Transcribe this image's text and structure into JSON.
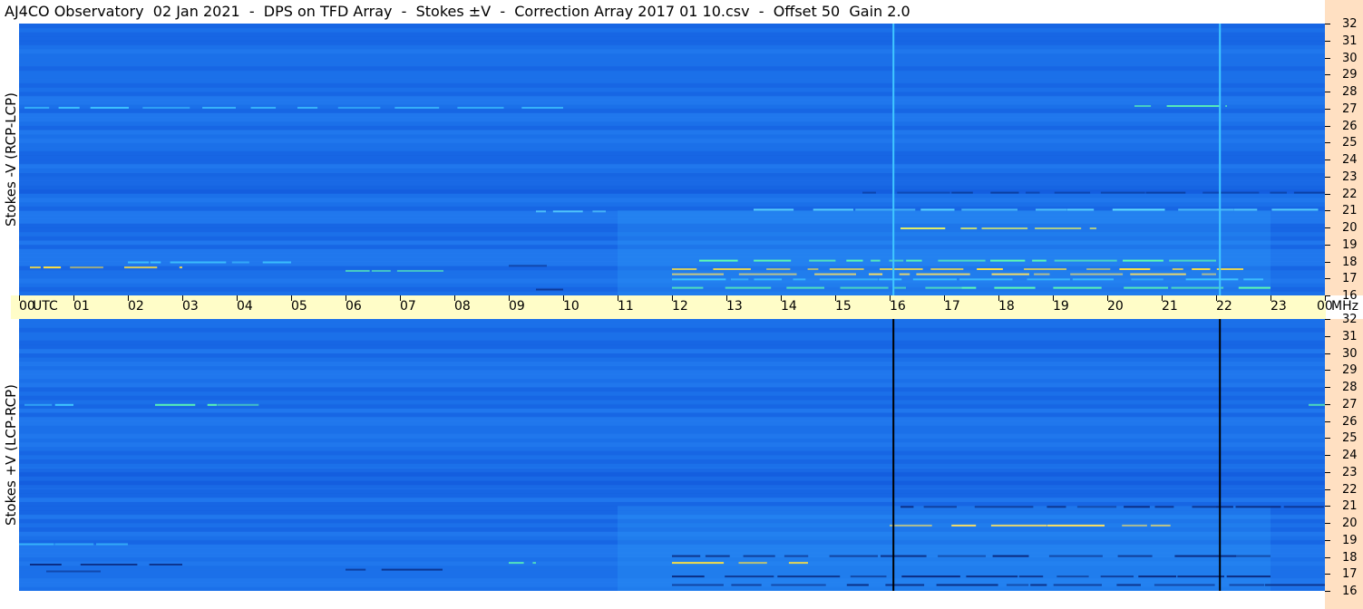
{
  "header": {
    "title": "AJ4CO Observatory  02 Jan 2021  -  DPS on TFD Array  -  Stokes ±V  -  Correction Array 2017 01 10.csv  -  Offset 50  Gain 2.0"
  },
  "chart_data": {
    "type": "heatmap",
    "colors": {
      "background_blue": "#1a6ee8",
      "dark_blue": "#0a3ec8",
      "cyan": "#40c8ff",
      "yellow": "#ffe040",
      "timebar": "#fffdc8",
      "freqbar": "#ffe0c2"
    },
    "x_axis": {
      "unit_label": "UTC",
      "ticks": [
        "00",
        "01",
        "02",
        "03",
        "04",
        "05",
        "06",
        "07",
        "08",
        "09",
        "10",
        "11",
        "12",
        "13",
        "14",
        "15",
        "16",
        "17",
        "18",
        "19",
        "20",
        "21",
        "22",
        "23",
        "00"
      ],
      "range_hours": [
        0,
        24
      ]
    },
    "y_axis": {
      "unit_label": "MHz",
      "ticks": [
        "32",
        "31",
        "30",
        "29",
        "28",
        "27",
        "26",
        "25",
        "24",
        "23",
        "22",
        "21",
        "20",
        "19",
        "18",
        "17",
        "16"
      ],
      "range_mhz": [
        16,
        32
      ]
    },
    "panels": [
      {
        "name": "Stokes -V (RCP-LCP)",
        "vertical_markers_utc": [
          16.07,
          22.07
        ],
        "marker_color": "#40c8ff"
      },
      {
        "name": "Stokes +V (LCP-RCP)",
        "vertical_markers_utc": [
          16.07,
          22.07
        ],
        "marker_color": "#000000"
      }
    ]
  }
}
